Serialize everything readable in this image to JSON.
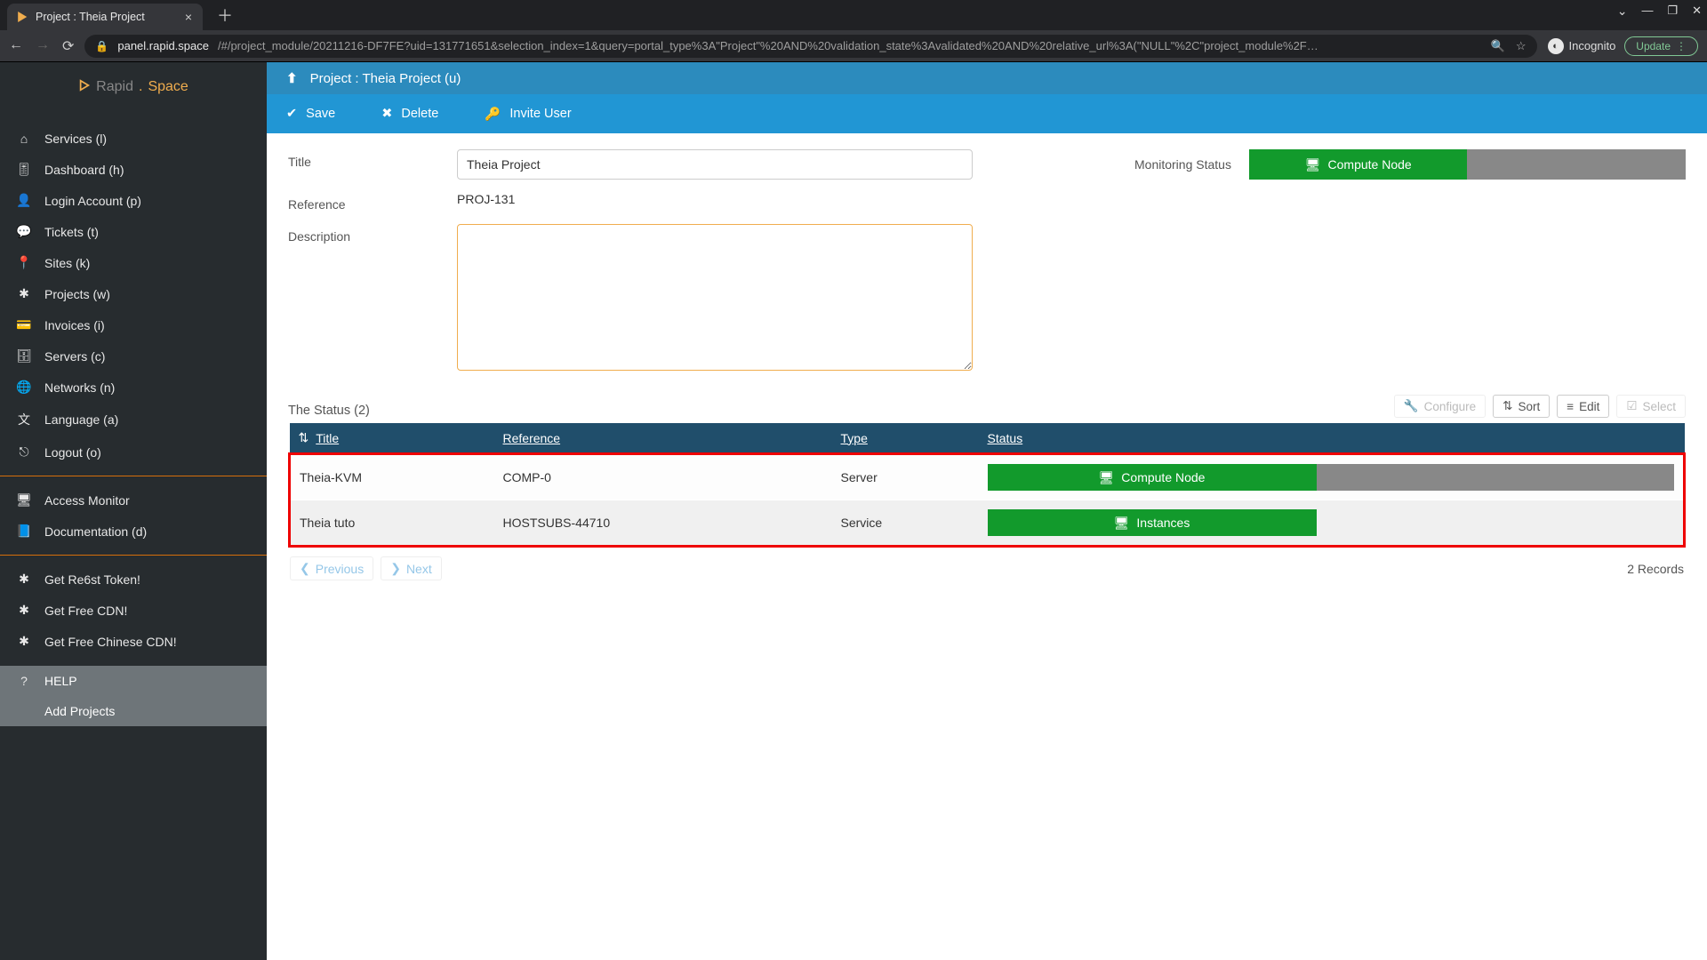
{
  "browser": {
    "tab_title": "Project : Theia Project",
    "url_host": "panel.rapid.space",
    "url_rest": "/#/project_module/20211216-DF7FE?uid=131771651&selection_index=1&query=portal_type%3A\"Project\"%20AND%20validation_state%3Avalidated%20AND%20relative_url%3A(\"NULL\"%2C\"project_module%2F…",
    "incognito": "Incognito",
    "update": "Update"
  },
  "logo": {
    "rapid": "Rapid",
    "space": "Space"
  },
  "sidebar": {
    "main": [
      "Services (l)",
      "Dashboard (h)",
      "Login Account (p)",
      "Tickets (t)",
      "Sites (k)",
      "Projects (w)",
      "Invoices (i)",
      "Servers (c)",
      "Networks (n)",
      "Language (a)",
      "Logout (o)"
    ],
    "support": [
      "Access Monitor",
      "Documentation (d)"
    ],
    "promo": [
      "Get Re6st Token!",
      "Get Free CDN!",
      "Get Free Chinese CDN!"
    ],
    "help": [
      "HELP",
      "Add Projects"
    ]
  },
  "header": {
    "title": "Project : Theia Project (u)"
  },
  "actions": {
    "save": "Save",
    "delete": "Delete",
    "invite": "Invite User"
  },
  "form": {
    "title_label": "Title",
    "title_value": "Theia Project",
    "reference_label": "Reference",
    "reference_value": "PROJ-131",
    "description_label": "Description",
    "description_value": "",
    "monitoring_label": "Monitoring Status",
    "compute_node": "Compute Node"
  },
  "status_table": {
    "heading": "The Status (2)",
    "tools": {
      "configure": "Configure",
      "sort": "Sort",
      "edit": "Edit",
      "select": "Select"
    },
    "columns": [
      "Title",
      "Reference",
      "Type",
      "Status"
    ],
    "rows": [
      {
        "title": "Theia-KVM",
        "reference": "COMP-0",
        "type": "Server",
        "btn": "Compute Node",
        "grey_tail": true
      },
      {
        "title": "Theia tuto",
        "reference": "HOSTSUBS-44710",
        "type": "Service",
        "btn": "Instances",
        "grey_tail": false
      }
    ],
    "prev": "Previous",
    "next": "Next",
    "records": "2 Records"
  }
}
